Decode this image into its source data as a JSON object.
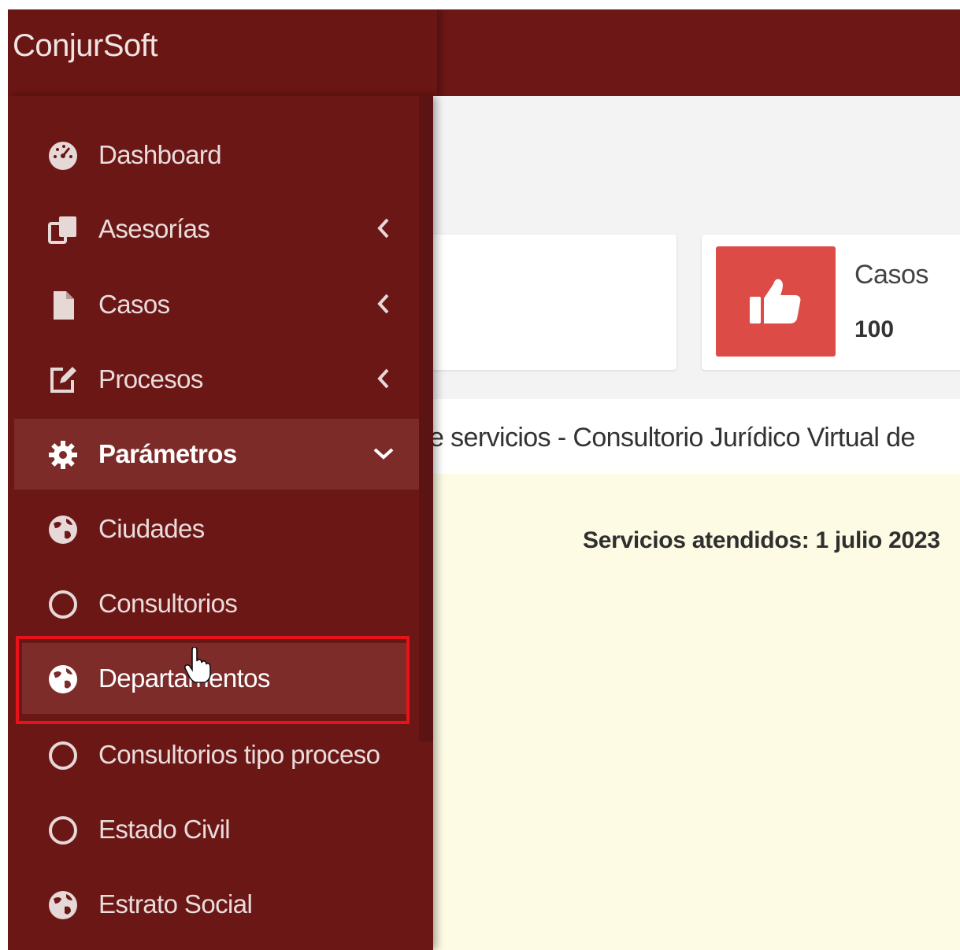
{
  "app": {
    "brand": "ConjurSoft"
  },
  "sidebar": {
    "items": [
      {
        "label": "Dashboard",
        "icon": "dashboard-gauge-icon"
      },
      {
        "label": "Asesorías",
        "icon": "copy-icon",
        "arrow": "chevron-left-icon"
      },
      {
        "label": "Casos",
        "icon": "file-icon",
        "arrow": "chevron-left-icon"
      },
      {
        "label": "Procesos",
        "icon": "edit-icon",
        "arrow": "chevron-left-icon"
      },
      {
        "label": "Parámetros",
        "icon": "gear-icon",
        "arrow": "chevron-down-icon",
        "expanded": true
      },
      {
        "label": "Ciudades",
        "icon": "globe-icon"
      },
      {
        "label": "Consultorios",
        "icon": "circle-outline-icon"
      },
      {
        "label": "Departamentos",
        "icon": "globe-icon",
        "hovered": true
      },
      {
        "label": "Consultorios tipo proceso",
        "icon": "circle-outline-icon"
      },
      {
        "label": "Estado Civil",
        "icon": "circle-outline-icon"
      },
      {
        "label": "Estrato Social",
        "icon": "globe-icon"
      }
    ]
  },
  "main": {
    "stat_card": {
      "label": "Casos",
      "value": "100",
      "icon": "thumbs-up-icon"
    },
    "subtitle": "e servicios - Consultorio Jurídico Virtual de",
    "panel_title": "Servicios atendidos: 1 julio 2023"
  },
  "colors": {
    "topbar": "#6d1816",
    "sidebar": "#6b1716",
    "sidebar_active": "#7c2b28",
    "stat_icon_bg": "#dd4b47",
    "highlight_border": "#e8131a",
    "panel_bg": "#fdfbe3"
  }
}
